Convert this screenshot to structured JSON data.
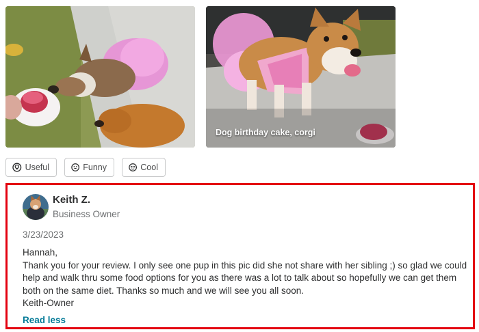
{
  "photos": [
    {
      "alt": "",
      "caption": ""
    },
    {
      "alt": "",
      "caption": "Dog birthday cake, corgi"
    }
  ],
  "reactions": [
    {
      "label": "Useful",
      "icon": "lightbulb-icon"
    },
    {
      "label": "Funny",
      "icon": "smile-icon"
    },
    {
      "label": "Cool",
      "icon": "sunglasses-icon"
    }
  ],
  "reply": {
    "owner_name": "Keith Z.",
    "owner_role": "Business Owner",
    "date": "3/23/2023",
    "lines": [
      "Hannah,",
      "Thank you for your review. I only see one pup in this pic did she not share with her sibling ;) so glad we could help and walk thru some food options for you as there was a lot to talk about so hopefully we can get them both on the same diet. Thanks so much and we will see you all soon.",
      "Keith-Owner"
    ],
    "read_less_label": "Read less"
  },
  "colors": {
    "highlight_border": "#e3000f",
    "link": "#027a97",
    "muted_text": "#6e7072"
  }
}
